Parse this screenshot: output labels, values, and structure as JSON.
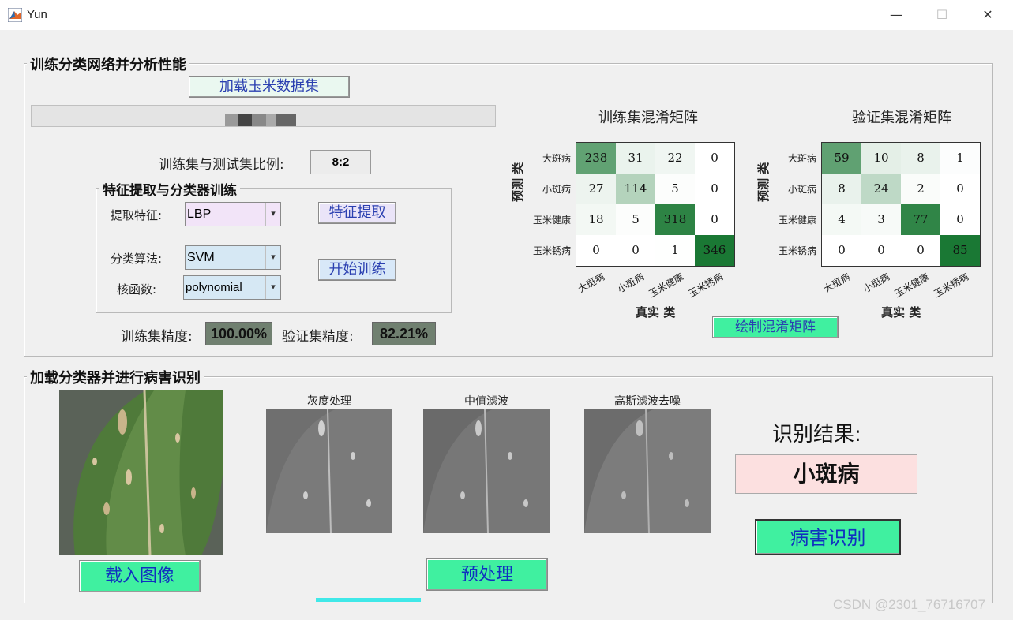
{
  "window": {
    "title": "Yun",
    "minimize": "—",
    "maximize": "☐",
    "close": "✕"
  },
  "train_panel": {
    "title": "训练分类网络并分析性能",
    "load_dataset_button": "加载玉米数据集",
    "ratio_label": "训练集与测试集比例:",
    "ratio_value": "8:2",
    "feature_group_title": "特征提取与分类器训练",
    "feature_label": "提取特征:",
    "feature_value": "LBP",
    "feature_button": "特征提取",
    "algo_label": "分类算法:",
    "algo_value": "SVM",
    "kernel_label": "核函数:",
    "kernel_value": "polynomial",
    "train_button": "开始训练",
    "train_acc_label": "训练集精度:",
    "train_acc_value": "100.00%",
    "val_acc_label": "验证集精度:",
    "val_acc_value": "82.21%",
    "plot_button": "绘制混淆矩阵",
    "colors": {
      "feature_select": "#f2e4f8",
      "algo_select": "#d6e8f4",
      "kernel_select": "#d6e8f4",
      "ratio_box": "#ececec"
    }
  },
  "chart_data": [
    {
      "type": "heatmap",
      "title": "训练集混淆矩阵",
      "xlabel": "真实 类",
      "ylabel": "预测 类",
      "x_categories": [
        "大斑病",
        "小斑病",
        "玉米健康",
        "玉米锈病"
      ],
      "y_categories": [
        "大斑病",
        "小斑病",
        "玉米健康",
        "玉米锈病"
      ],
      "values": [
        [
          238,
          31,
          22,
          0
        ],
        [
          27,
          114,
          5,
          0
        ],
        [
          18,
          5,
          318,
          0
        ],
        [
          0,
          0,
          1,
          346
        ]
      ]
    },
    {
      "type": "heatmap",
      "title": "验证集混淆矩阵",
      "xlabel": "真实 类",
      "ylabel": "预测 类",
      "x_categories": [
        "大斑病",
        "小斑病",
        "玉米健康",
        "玉米锈病"
      ],
      "y_categories": [
        "大斑病",
        "小斑病",
        "玉米健康",
        "玉米锈病"
      ],
      "values": [
        [
          59,
          10,
          8,
          1
        ],
        [
          8,
          24,
          2,
          0
        ],
        [
          4,
          3,
          77,
          0
        ],
        [
          0,
          0,
          0,
          85
        ]
      ]
    }
  ],
  "detect_panel": {
    "title": "加载分类器并进行病害识别",
    "load_image_button": "载入图像",
    "gray_caption": "灰度处理",
    "median_caption": "中值滤波",
    "gauss_caption": "高斯滤波去噪",
    "preprocess_button": "预处理",
    "result_label": "识别结果:",
    "result_value": "小斑病",
    "identify_button": "病害识别",
    "colors": {
      "result_box": "#fce0e0",
      "button_green": "#40f0a0"
    }
  },
  "watermark": "CSDN @2301_76716707"
}
